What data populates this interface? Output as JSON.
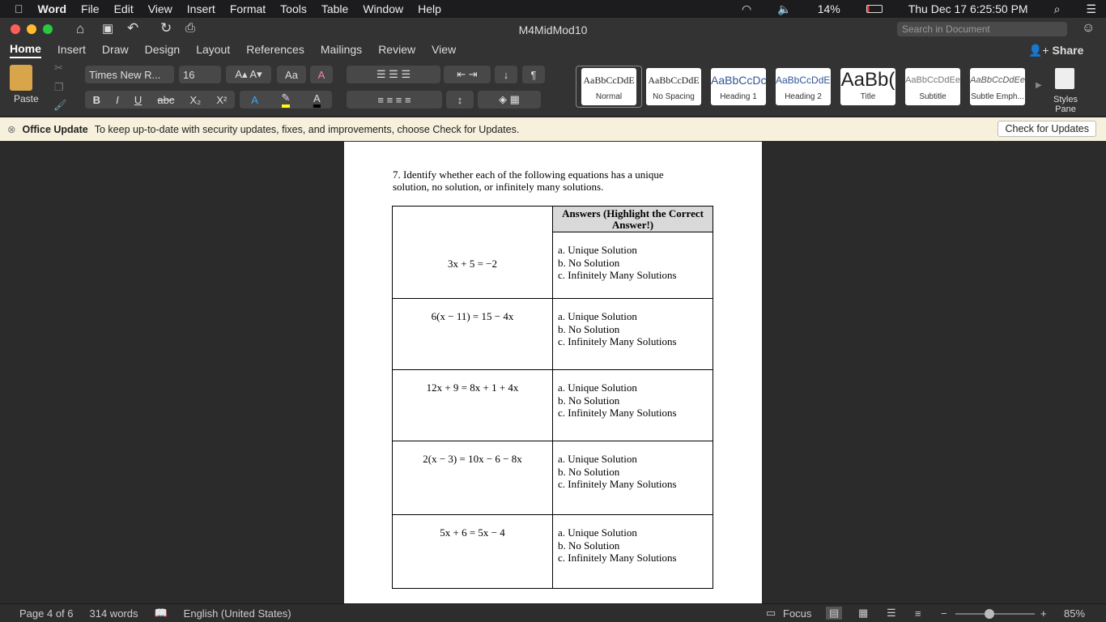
{
  "menubar": {
    "app": "Word",
    "items": [
      "File",
      "Edit",
      "View",
      "Insert",
      "Format",
      "Tools",
      "Table",
      "Window",
      "Help"
    ],
    "battery": "14%",
    "clock": "Thu Dec 17  6:25:50 PM"
  },
  "title": "M4MidMod10",
  "search_placeholder": "Search in Document",
  "share": "Share",
  "tabs": [
    "Home",
    "Insert",
    "Draw",
    "Design",
    "Layout",
    "References",
    "Mailings",
    "Review",
    "View"
  ],
  "ribbon": {
    "paste": "Paste",
    "font": "Times New R...",
    "size": "16",
    "styles": [
      {
        "sample": "AaBbCcDdE",
        "label": "Normal"
      },
      {
        "sample": "AaBbCcDdE",
        "label": "No Spacing"
      },
      {
        "sample": "AaBbCcDc",
        "label": "Heading 1"
      },
      {
        "sample": "AaBbCcDdEe",
        "label": "Heading 2"
      },
      {
        "sample": "AaBb(",
        "label": "Title"
      },
      {
        "sample": "AaBbCcDdEe",
        "label": "Subtitle"
      },
      {
        "sample": "AaBbCcDdEe",
        "label": "Subtle Emph..."
      }
    ],
    "styles_pane": "Styles Pane"
  },
  "update": {
    "title": "Office Update",
    "message": "To keep up-to-date with security updates, fixes, and improvements, choose Check for Updates.",
    "button": "Check for Updates"
  },
  "doc": {
    "question": "7. Identify whether each of the following equations has a unique solution, no solution, or infinitely many solutions.",
    "header": "Answers (Highlight the Correct Answer!)",
    "rows": [
      {
        "eq": "3x + 5 = −2"
      },
      {
        "eq": "6(x − 11) = 15 − 4x"
      },
      {
        "eq": "12x + 9 = 8x + 1 + 4x"
      },
      {
        "eq": "2(x − 3) = 10x − 6 − 8x"
      },
      {
        "eq": "5x + 6 = 5x − 4"
      }
    ],
    "options": [
      "a. Unique Solution",
      "b. No Solution",
      "c. Infinitely Many Solutions"
    ]
  },
  "status": {
    "page": "Page 4 of 6",
    "words": "314 words",
    "language": "English (United States)",
    "focus": "Focus",
    "zoom": "85%"
  }
}
